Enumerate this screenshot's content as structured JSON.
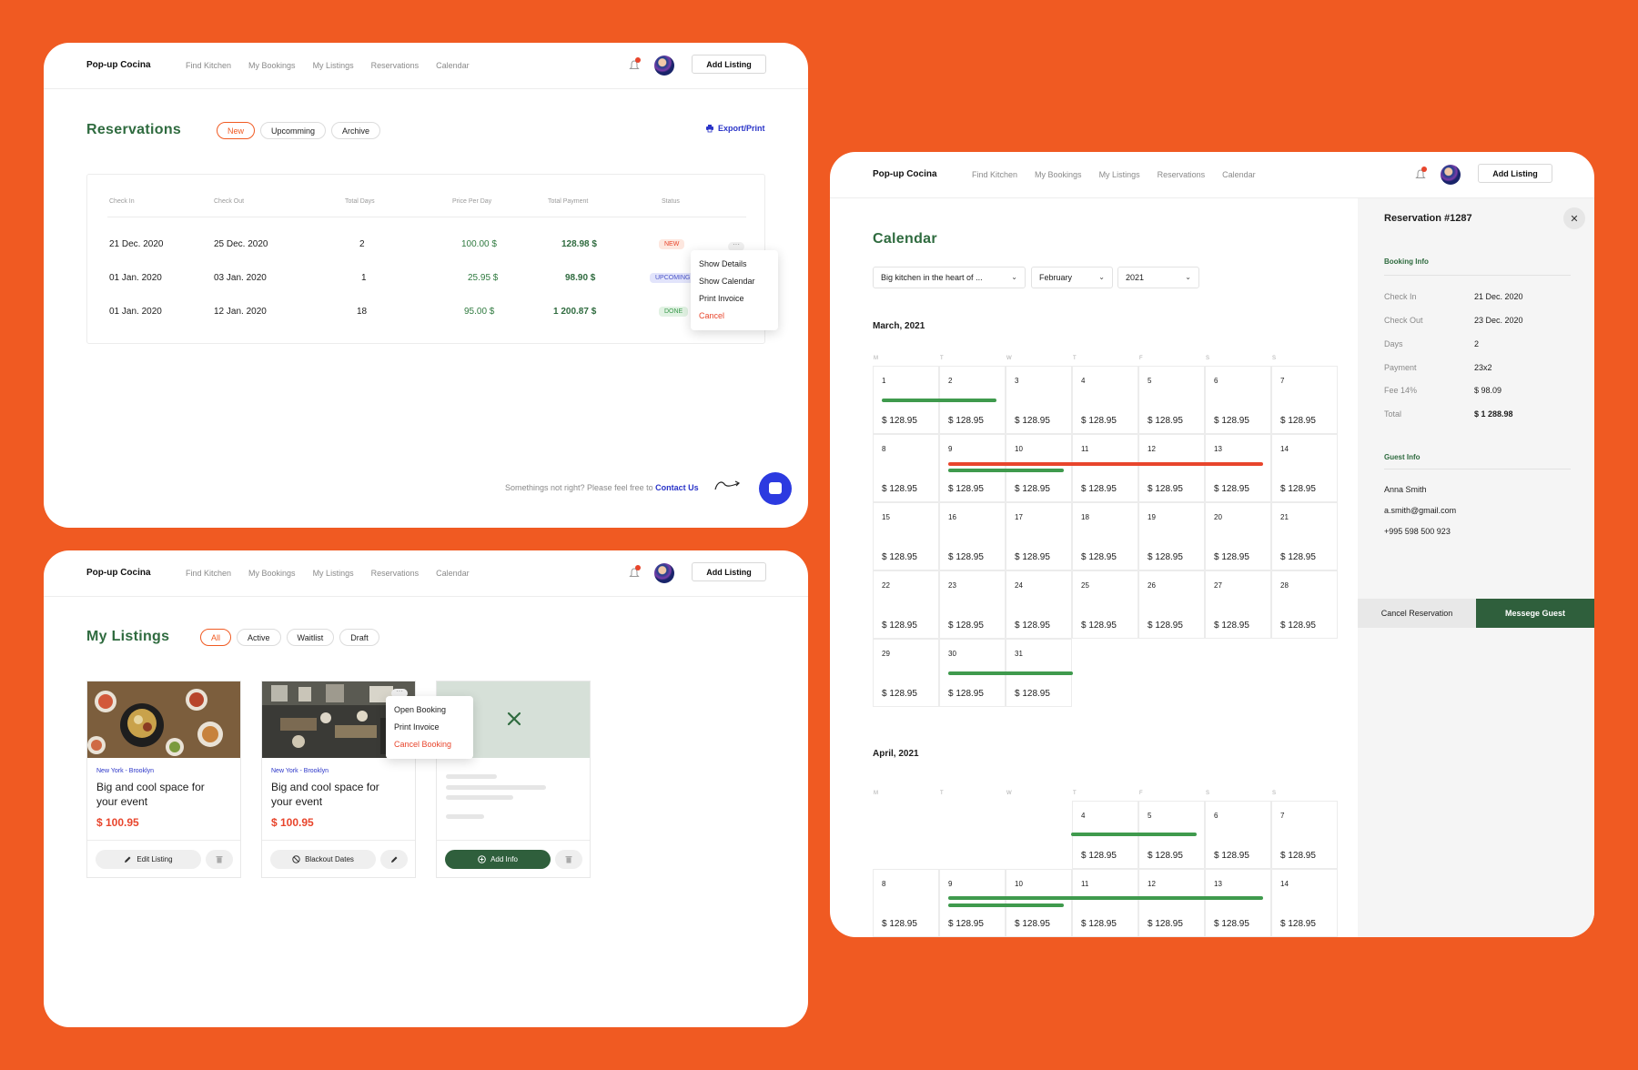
{
  "colors": {
    "background": "#f05a22",
    "accent_green": "#2f6b3f",
    "accent_red": "#e8452c",
    "link_blue": "#2a34c8"
  },
  "nav": {
    "brand": "Pop-up Cocina",
    "links": [
      "Find Kitchen",
      "My Bookings",
      "My Listings",
      "Reservations",
      "Calendar"
    ],
    "add_listing": "Add Listing",
    "icons": {
      "notifications": "bell-icon",
      "avatar": "user-avatar"
    }
  },
  "reservations": {
    "title": "Reservations",
    "tabs": [
      "New",
      "Upcomming",
      "Archive"
    ],
    "active_tab": "New",
    "export": "Export/Print",
    "columns": [
      "Check In",
      "Check Out",
      "Total Days",
      "Price Per Day",
      "Total Payment",
      "Status"
    ],
    "rows": [
      {
        "check_in": "21 Dec. 2020",
        "check_out": "25 Dec. 2020",
        "days": "2",
        "price": "100.00 $",
        "total": "128.98 $",
        "status": "NEW"
      },
      {
        "check_in": "01 Jan. 2020",
        "check_out": "03 Jan. 2020",
        "days": "1",
        "price": "25.95 $",
        "total": "98.90 $",
        "status": "UPCOMING"
      },
      {
        "check_in": "01 Jan. 2020",
        "check_out": "12 Jan. 2020",
        "days": "18",
        "price": "95.00 $",
        "total": "1 200.87 $",
        "status": "DONE"
      }
    ],
    "row_menu": [
      "Show Details",
      "Show Calendar",
      "Print Invoice",
      "Cancel"
    ],
    "row_menu_more": "···",
    "help_text": "Somethings not right? Please feel free to",
    "help_link": "Contact Us"
  },
  "listings": {
    "title": "My Listings",
    "tabs": [
      "All",
      "Active",
      "Waitlist",
      "Draft"
    ],
    "active_tab": "All",
    "cards": [
      {
        "location": "New York - Brooklyn",
        "title": "Big and cool space for your event",
        "price": "$ 100.95",
        "action": "Edit Listing"
      },
      {
        "location": "New York - Brooklyn",
        "title": "Big and cool space for your event",
        "price": "$ 100.95",
        "action": "Blackout Dates"
      },
      {
        "action": "Add Info"
      }
    ],
    "card_menu": [
      "Open Booking",
      "Print Invoice",
      "Cancel Booking"
    ],
    "card_menu_more": "···"
  },
  "calendar": {
    "title": "Calendar",
    "filters": {
      "kitchen": "Big kitchen in the heart of ...",
      "month": "February",
      "year": "2021"
    },
    "weekdays": [
      "M",
      "T",
      "W",
      "T",
      "F",
      "S",
      "S"
    ],
    "price": "$ 128.95",
    "months": [
      {
        "name": "March, 2021",
        "days": [
          "1",
          "2",
          "3",
          "4",
          "5",
          "6",
          "7",
          "8",
          "9",
          "10",
          "11",
          "12",
          "13",
          "14",
          "15",
          "16",
          "17",
          "18",
          "19",
          "20",
          "21",
          "22",
          "23",
          "24",
          "25",
          "26",
          "27",
          "28",
          "29",
          "30",
          "31"
        ]
      },
      {
        "name": "April, 2021",
        "days": [
          "4",
          "5",
          "6",
          "7",
          "8",
          "9",
          "10",
          "11",
          "12",
          "13",
          "14"
        ]
      }
    ]
  },
  "reservation_detail": {
    "title": "Reservation #1287",
    "close": "✕",
    "booking_heading": "Booking Info",
    "booking": [
      {
        "label": "Check In",
        "value": "21 Dec. 2020"
      },
      {
        "label": "Check Out",
        "value": "23 Dec. 2020"
      },
      {
        "label": "Days",
        "value": "2"
      },
      {
        "label": "Payment",
        "value": "23x2"
      },
      {
        "label": "Fee 14%",
        "value": "$ 98.09"
      },
      {
        "label": "Total",
        "value": "$ 1 288.98"
      }
    ],
    "guest_heading": "Guest Info",
    "guest": {
      "name": "Anna Smith",
      "email": "a.smith@gmail.com",
      "phone": "+995 598 500 923"
    },
    "cancel": "Cancel Reservation",
    "message": "Messege Guest"
  }
}
